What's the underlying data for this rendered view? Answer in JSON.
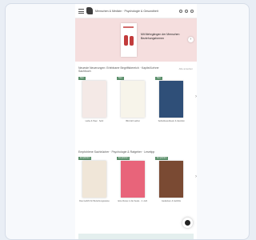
{
  "header": {
    "title": "Menschen & Medizin · Psychologie & Gesundheit",
    "icons": [
      "menu-icon",
      "logo",
      "search-icon",
      "account-icon",
      "cart-icon"
    ]
  },
  "hero": {
    "text": "Mit Mehrgängen der Menschen Beziehungsformen"
  },
  "section1": {
    "title": "Neueste Neuerungen: Erlebbarer Begriffsbereich · Kapitel/Lehrer Sachbuch",
    "more": "Alle ansehen",
    "items": [
      {
        "badge": "Neu",
        "label": "Liebe & Paar · Sehr",
        "sub": "Gebundene Ausgabe",
        "color": "#f4e9e6"
      },
      {
        "badge": "Neu",
        "label": "Bild dich selbst",
        "sub": "Taschenbuch",
        "color": "#f7f4ea"
      },
      {
        "badge": "Neu",
        "label": "Selbstbewußtsein & Identität",
        "sub": "Taschenbuch",
        "color": "#2f4f78"
      }
    ]
  },
  "section2": {
    "title": "Empfohlene Sachbücher · Psychologie & Ratgeber · Lesetipp",
    "items": [
      {
        "badge": "Empfohlen",
        "label": "Das Gefühl für Beziehungsweise",
        "sub": "Taschenbuch",
        "color": "#f0e6d8"
      },
      {
        "badge": "Empfohlen",
        "label": "Eine Reise in die Seele · 2. Aufl.",
        "sub": "Taschenbuch",
        "color": "#e8647a"
      },
      {
        "badge": "Empfohlen",
        "label": "Gedanken & Gefühle",
        "sub": "Taschenbuch",
        "color": "#7a4a33"
      }
    ]
  }
}
